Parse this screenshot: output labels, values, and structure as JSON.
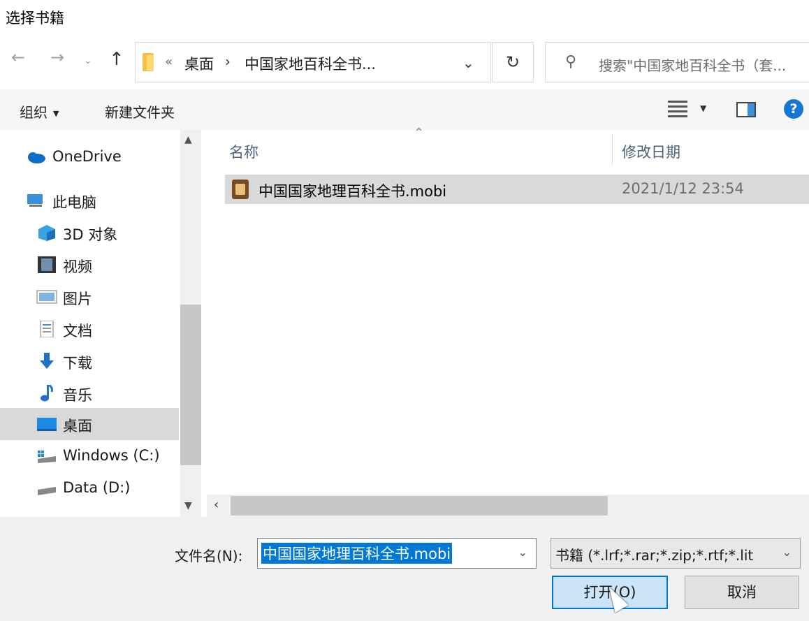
{
  "window": {
    "title": "选择书籍"
  },
  "address_bar": {
    "overflow_marker": "«",
    "breadcrumbs": [
      "桌面",
      "中国家地百科全书..."
    ],
    "separator": "›"
  },
  "search": {
    "placeholder": "搜索\"中国家地百科全书（套..."
  },
  "toolbar": {
    "organize_label": "组织",
    "new_folder_label": "新建文件夹"
  },
  "nav_pane": {
    "items": [
      {
        "label": "OneDrive",
        "icon": "cloud-icon"
      },
      {
        "label": "此电脑",
        "icon": "computer-icon"
      },
      {
        "label": "3D 对象",
        "icon": "cube-icon"
      },
      {
        "label": "视频",
        "icon": "film-icon"
      },
      {
        "label": "图片",
        "icon": "picture-icon"
      },
      {
        "label": "文档",
        "icon": "document-icon"
      },
      {
        "label": "下载",
        "icon": "download-arrow-icon"
      },
      {
        "label": "音乐",
        "icon": "music-note-icon"
      },
      {
        "label": "桌面",
        "icon": "desktop-icon",
        "selected": true
      },
      {
        "label": "Windows (C:)",
        "icon": "windows-drive-icon"
      },
      {
        "label": "Data (D:)",
        "icon": "drive-icon"
      }
    ]
  },
  "file_list": {
    "columns": [
      "名称",
      "修改日期"
    ],
    "rows": [
      {
        "name": "中国国家地理百科全书.mobi",
        "modified": "2021/1/12 23:54",
        "icon": "ebook-file-icon",
        "selected": true
      }
    ]
  },
  "footer": {
    "filename_label": "文件名(N):",
    "filename_value": "中国国家地理百科全书.mobi",
    "filetype_value": "书籍 (*.lrf;*.rar;*.zip;*.rtf;*.lit",
    "open_label": "打开(O)",
    "cancel_label": "取消"
  },
  "colors": {
    "accent": "#0078d7",
    "help": "#1677d2",
    "selection": "#d9d9d9"
  }
}
